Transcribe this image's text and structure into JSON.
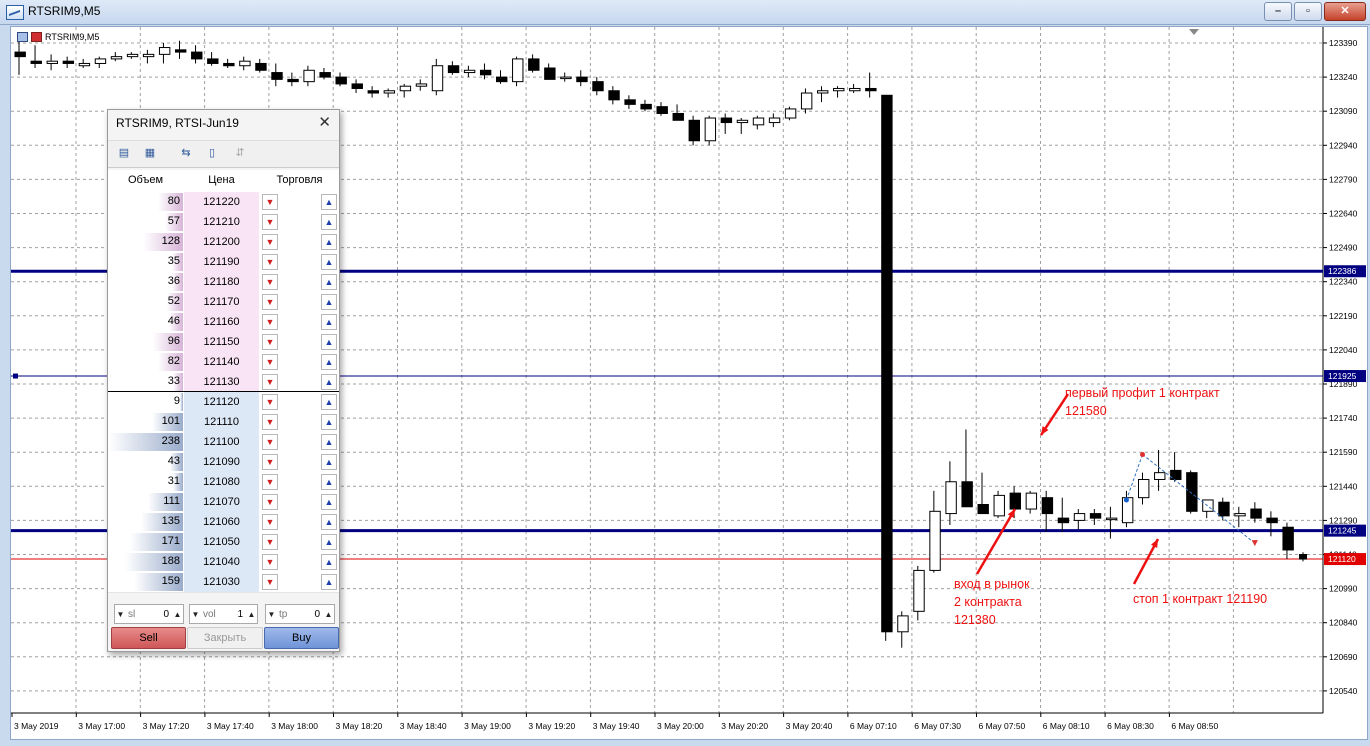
{
  "window": {
    "title": "RTSRIM9,M5"
  },
  "chart": {
    "label": "RTSRIM9,M5",
    "price_labels": [
      "123390",
      "123240",
      "123090",
      "122940",
      "122790",
      "122640",
      "122490",
      "122340",
      "122190",
      "122040",
      "121890",
      "121740",
      "121590",
      "121440",
      "121290",
      "121140",
      "120990",
      "120840",
      "120690",
      "120540"
    ],
    "price_top": 123390,
    "price_step": 150,
    "time_labels": [
      "3 May 2019",
      "3 May 17:00",
      "3 May 17:20",
      "3 May 17:40",
      "3 May 18:00",
      "3 May 18:20",
      "3 May 18:40",
      "3 May 19:00",
      "3 May 19:20",
      "3 May 19:40",
      "3 May 20:00",
      "3 May 20:20",
      "3 May 20:40",
      "6 May 07:10",
      "6 May 07:30",
      "6 May 07:50",
      "6 May 08:10",
      "6 May 08:30",
      "6 May 08:50"
    ],
    "hlines": [
      {
        "price": 122386,
        "label": "122386",
        "color": "#000080",
        "width": "thick"
      },
      {
        "price": 121925,
        "label": "121925",
        "color": "#000080",
        "width": "thin"
      },
      {
        "price": 121245,
        "label": "121245",
        "color": "#000080",
        "width": "thick"
      },
      {
        "price": 121120,
        "label": "121120",
        "color": "#e00000",
        "width": "thin"
      }
    ],
    "candles": [
      [
        123350,
        123400,
        123250,
        123330
      ],
      [
        123310,
        123380,
        123280,
        123300
      ],
      [
        123300,
        123340,
        123270,
        123310
      ],
      [
        123310,
        123330,
        123280,
        123300
      ],
      [
        123290,
        123320,
        123280,
        123300
      ],
      [
        123300,
        123330,
        123280,
        123320
      ],
      [
        123320,
        123350,
        123310,
        123330
      ],
      [
        123330,
        123350,
        123320,
        123340
      ],
      [
        123330,
        123360,
        123300,
        123340
      ],
      [
        123340,
        123390,
        123300,
        123370
      ],
      [
        123360,
        123400,
        123320,
        123350
      ],
      [
        123350,
        123380,
        123300,
        123320
      ],
      [
        123320,
        123350,
        123290,
        123300
      ],
      [
        123300,
        123320,
        123280,
        123290
      ],
      [
        123290,
        123330,
        123270,
        123310
      ],
      [
        123300,
        123320,
        123260,
        123270
      ],
      [
        123260,
        123300,
        123200,
        123230
      ],
      [
        123230,
        123260,
        123200,
        123220
      ],
      [
        123220,
        123290,
        123200,
        123270
      ],
      [
        123260,
        123280,
        123230,
        123240
      ],
      [
        123240,
        123260,
        123200,
        123210
      ],
      [
        123210,
        123230,
        123170,
        123190
      ],
      [
        123180,
        123200,
        123150,
        123170
      ],
      [
        123170,
        123190,
        123150,
        123180
      ],
      [
        123180,
        123210,
        123150,
        123200
      ],
      [
        123200,
        123230,
        123180,
        123210
      ],
      [
        123180,
        123320,
        123160,
        123290
      ],
      [
        123290,
        123310,
        123250,
        123260
      ],
      [
        123260,
        123290,
        123240,
        123270
      ],
      [
        123270,
        123300,
        123230,
        123250
      ],
      [
        123240,
        123270,
        123210,
        123220
      ],
      [
        123220,
        123330,
        123200,
        123320
      ],
      [
        123320,
        123340,
        123260,
        123270
      ],
      [
        123280,
        123300,
        123230,
        123230
      ],
      [
        123240,
        123260,
        123220,
        123240
      ],
      [
        123240,
        123270,
        123200,
        123220
      ],
      [
        123220,
        123240,
        123160,
        123180
      ],
      [
        123180,
        123200,
        123120,
        123140
      ],
      [
        123140,
        123160,
        123100,
        123120
      ],
      [
        123120,
        123140,
        123090,
        123100
      ],
      [
        123110,
        123130,
        123070,
        123080
      ],
      [
        123080,
        123120,
        123050,
        123050
      ],
      [
        123050,
        123070,
        122940,
        122960
      ],
      [
        122960,
        123070,
        122940,
        123060
      ],
      [
        123060,
        123080,
        122990,
        123040
      ],
      [
        123040,
        123060,
        122990,
        123050
      ],
      [
        123030,
        123070,
        123010,
        123060
      ],
      [
        123040,
        123080,
        123020,
        123060
      ],
      [
        123060,
        123110,
        123050,
        123100
      ],
      [
        123100,
        123190,
        123080,
        123170
      ],
      [
        123170,
        123200,
        123130,
        123180
      ],
      [
        123180,
        123200,
        123150,
        123190
      ],
      [
        123180,
        123210,
        123170,
        123190
      ],
      [
        123190,
        123260,
        123150,
        123180
      ],
      [
        123160,
        123160,
        120760,
        120800
      ],
      [
        120800,
        120890,
        120730,
        120870
      ],
      [
        120890,
        121090,
        120850,
        121070
      ],
      [
        121070,
        121420,
        121060,
        121330
      ],
      [
        121320,
        121550,
        121270,
        121460
      ],
      [
        121460,
        121690,
        121360,
        121350
      ],
      [
        121360,
        121500,
        121320,
        121320
      ],
      [
        121310,
        121420,
        121300,
        121400
      ],
      [
        121410,
        121440,
        121300,
        121340
      ],
      [
        121340,
        121420,
        121320,
        121410
      ],
      [
        121390,
        121420,
        121240,
        121320
      ],
      [
        121300,
        121390,
        121240,
        121280
      ],
      [
        121290,
        121340,
        121250,
        121320
      ],
      [
        121320,
        121340,
        121270,
        121300
      ],
      [
        121300,
        121350,
        121210,
        121300
      ],
      [
        121280,
        121420,
        121260,
        121390
      ],
      [
        121390,
        121500,
        121360,
        121470
      ],
      [
        121470,
        121600,
        121420,
        121500
      ],
      [
        121510,
        121590,
        121460,
        121470
      ],
      [
        121500,
        121510,
        121320,
        121330
      ],
      [
        121330,
        121380,
        121300,
        121380
      ],
      [
        121370,
        121390,
        121290,
        121310
      ],
      [
        121310,
        121350,
        121260,
        121320
      ],
      [
        121340,
        121370,
        121280,
        121300
      ],
      [
        121300,
        121330,
        121220,
        121280
      ],
      [
        121260,
        121280,
        121120,
        121160
      ],
      [
        121140,
        121150,
        121110,
        121120
      ]
    ],
    "markers": [
      {
        "price": 121380,
        "type": "entry"
      },
      {
        "price": 121580,
        "type": "profit"
      },
      {
        "price": 121190,
        "type": "stop"
      }
    ],
    "annotations": [
      {
        "lines": [
          "первый профит 1 контракт",
          "121580"
        ]
      },
      {
        "lines": [
          "вход в рынок",
          "2 контракта",
          "121380"
        ]
      },
      {
        "lines": [
          "стоп 1 контракт 121190"
        ]
      }
    ]
  },
  "dom_panel": {
    "title": "RTSRIM9, RTSI-Jun19",
    "close_glyph": "✕",
    "headers": {
      "volume": "Объем",
      "price": "Цена",
      "trade": "Торговля"
    },
    "max_volume": 238,
    "asks": [
      {
        "volume": "80",
        "price": "121220"
      },
      {
        "volume": "57",
        "price": "121210"
      },
      {
        "volume": "128",
        "price": "121200"
      },
      {
        "volume": "35",
        "price": "121190"
      },
      {
        "volume": "36",
        "price": "121180"
      },
      {
        "volume": "52",
        "price": "121170"
      },
      {
        "volume": "46",
        "price": "121160"
      },
      {
        "volume": "96",
        "price": "121150"
      },
      {
        "volume": "82",
        "price": "121140"
      },
      {
        "volume": "33",
        "price": "121130"
      }
    ],
    "bids": [
      {
        "volume": "9",
        "price": "121120"
      },
      {
        "volume": "101",
        "price": "121110"
      },
      {
        "volume": "238",
        "price": "121100"
      },
      {
        "volume": "43",
        "price": "121090"
      },
      {
        "volume": "31",
        "price": "121080"
      },
      {
        "volume": "111",
        "price": "121070"
      },
      {
        "volume": "135",
        "price": "121060"
      },
      {
        "volume": "171",
        "price": "121050"
      },
      {
        "volume": "188",
        "price": "121040"
      },
      {
        "volume": "159",
        "price": "121030"
      }
    ],
    "controls": {
      "sl_label": "sl",
      "sl_value": "0",
      "vol_label": "vol",
      "vol_value": "1",
      "tp_label": "tp",
      "tp_value": "0"
    },
    "buttons": {
      "sell": "Sell",
      "close": "Закрыть",
      "buy": "Buy"
    },
    "colors": {
      "ask_bar": "#d6b4d7",
      "bid_bar": "#9aaccb",
      "ask_bg": "#f8e4f5",
      "bid_bg": "#dde8f7"
    }
  }
}
